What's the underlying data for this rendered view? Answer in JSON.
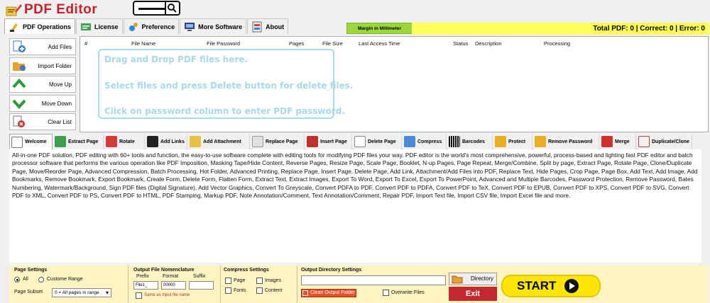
{
  "app": {
    "title": "PDF Editor"
  },
  "tabs": [
    {
      "label": "PDF Operations",
      "icon": "pdf-operations-icon",
      "color": "#ffffff"
    },
    {
      "label": "License",
      "icon": "license-icon",
      "color": "#3ba14a"
    },
    {
      "label": "Preference",
      "icon": "preference-icon",
      "color": "#2a8ad3"
    },
    {
      "label": "More Software",
      "icon": "more-software-icon",
      "color": "#3a3a8a"
    },
    {
      "label": "About",
      "icon": "about-icon",
      "color": "#d04040"
    }
  ],
  "header": {
    "margin_label": "Margin in Millimeter",
    "totals": "Total PDF: 0  |  Correct: 0  |  Error: 0",
    "totals_color": "#ffff5a"
  },
  "side_buttons": [
    {
      "label": "Add Files",
      "icon": "add-files-icon"
    },
    {
      "label": "Import Folder",
      "icon": "import-folder-icon"
    },
    {
      "label": "Move Up",
      "icon": "move-up-icon"
    },
    {
      "label": "Move Down",
      "icon": "move-down-icon"
    },
    {
      "label": "Clear List",
      "icon": "clear-list-icon"
    }
  ],
  "grid": {
    "columns": [
      "#",
      "File Name",
      "File Password",
      "Pages",
      "File Size",
      "Last Access Time",
      "Status",
      "Description",
      "Processing"
    ]
  },
  "dropzone": {
    "line1": "Drag and Drop PDF files here.",
    "line2": "Select files and press Delete button for delete files.",
    "line3": "Click on password column to enter PDF password."
  },
  "feature_tabs": [
    {
      "label": "Welcome",
      "icon": "welcome-icon"
    },
    {
      "label": "Extract Page",
      "icon": "extract-page-icon"
    },
    {
      "label": "Rotate",
      "icon": "rotate-icon"
    },
    {
      "label": "Add Links",
      "icon": "add-links-icon"
    },
    {
      "label": "Add Attachment",
      "icon": "add-attachment-icon"
    },
    {
      "label": "Replace Page",
      "icon": "replace-page-icon"
    },
    {
      "label": "Insert Page",
      "icon": "insert-page-icon"
    },
    {
      "label": "Delete Page",
      "icon": "delete-page-icon"
    },
    {
      "label": "Compress",
      "icon": "compress-icon"
    },
    {
      "label": "Barcodes",
      "icon": "barcodes-icon"
    },
    {
      "label": "Protect",
      "icon": "protect-icon"
    },
    {
      "label": "Remove Password",
      "icon": "remove-password-icon"
    },
    {
      "label": "Merge",
      "icon": "merge-icon"
    },
    {
      "label": "Duplicate/Clone",
      "icon": "duplicate-clone-icon"
    }
  ],
  "description": "All-in-one PDF solution, PDF editing with 60+ tools and function, the easy-to-use software complete with editing tools for modifying PDF files your way. PDF editor is the world's most comprehensive, powerful, process-based and lighting fast PDF editor and batch processor software that performs the various operation like PDF Imposition, Masking Tape/Hide Content, Reverse Pages, Resize Page, Scale Page, Booklet, N-up Pages, Page Repeat, Merge/Combine, Split by page, Extract Page, Rotate Page, Clone/Duplicate Page, Move/Reorder Page, Advanced Compression, Batch Processing, Hot Folder, Advanced Printing, Replace Page, Insert Page, Delete Page, Add Link, Attachment/Add Files into PDF, Replace Text, Hide Pages, Crop Page, Page Box, Add Text, Add Image, Add Bookmarks, Remove Bookmark, Export Bookmark, Create Form, Delete Form, Flatten Form, Extract Text, Extract Images, Export To Word, Export To Excel, Export To PowerPoint, Advanced and Multiple Barcodes, Password Protection, Remove Password, Bates Numbering,  Watermark/Background, Sign PDF files (Digital Signature), Add Vector Graphics, Convert To Greyscale, Convert PDFA to PDF, Convert PDF to PDFA, Convert PDF to TeX, Convert PDF to EPUB, Convert PDF to XPS, Convert PDF to SVG, Convert PDF to XML, Convert PDF to PS, Convert PDF to HTML, PDF Stamping, Markup PDF, Note Annotation/Comment, Text Annotation/Comment, Repair PDF, Import Text file, Import CSV file, Import Excel file and more.",
  "page_settings": {
    "title": "Page Settings",
    "all": "All",
    "custom": "Custome Range",
    "subset_label": "Page Subset",
    "subset_value": "0 = All pages in range"
  },
  "nomenclature": {
    "title": "Output File Nomenclature",
    "prefix_label": "Prefix",
    "format_label": "Format",
    "suffix_label": "Suffix",
    "prefix_value": "File1_",
    "format_value": "00000",
    "suffix_value": "",
    "same_as_input": "Same as input file name"
  },
  "compress": {
    "title": "Compress Settings",
    "page": "Page",
    "images": "Images",
    "fonts": "Fonts",
    "content": "Content"
  },
  "output_dir": {
    "title": "Output Directory Settings",
    "path": "",
    "clean": "Clean Output Folder",
    "overwrite": "Overwrite Files",
    "directory_button": "Directory"
  },
  "actions": {
    "exit": "Exit",
    "start": "START"
  }
}
